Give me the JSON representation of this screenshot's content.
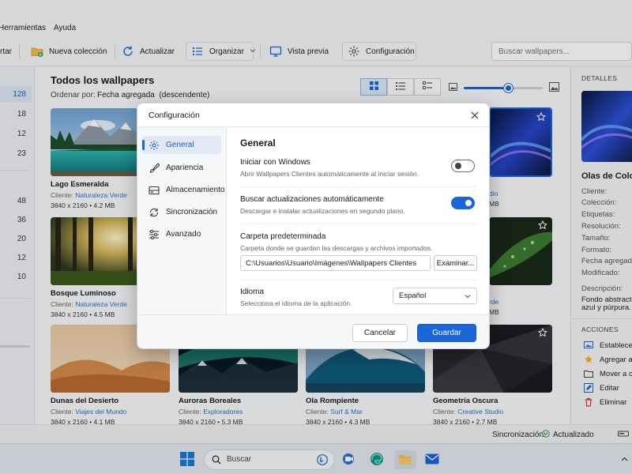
{
  "menubar": {
    "items": [
      "Herramientas",
      "Ayuda"
    ]
  },
  "toolbar": {
    "items": [
      {
        "label": "rtar",
        "icon": "import-icon"
      },
      {
        "label": "Nueva colección",
        "icon": "new-folder-icon"
      },
      {
        "label": "Actualizar",
        "icon": "refresh-icon"
      },
      {
        "label": "Organizar",
        "icon": "list-icon"
      },
      {
        "label": "Vista previa",
        "icon": "monitor-icon"
      },
      {
        "label": "Configuración",
        "icon": "gear-icon"
      }
    ],
    "search_placeholder": "Buscar wallpapers..."
  },
  "sidebar": {
    "counts": [
      "128",
      "18",
      "12",
      "23",
      "48",
      "36",
      "20",
      "12",
      "10"
    ]
  },
  "main": {
    "title": "Todos los wallpapers",
    "sort_label": "Ordenar por:",
    "sort_value": "Fecha agregada",
    "sort_dir": "(descendente)",
    "zoom_level": 0.56,
    "cards": [
      {
        "name": "Lago Esmeralda",
        "client_label": "Cliente:",
        "client": "Naturaleza Verde",
        "resolution": "3840 x 2160",
        "size": "4.2 MB"
      },
      {
        "name": "",
        "client_label": "",
        "client": "dio",
        "resolution": "",
        "size": "MB"
      },
      {
        "name": "Bosque Luminoso",
        "client_label": "Cliente:",
        "client": "Naturaleza Verde",
        "resolution": "3840 x 2160",
        "size": "4.5 MB"
      },
      {
        "name": "",
        "client_label": "",
        "client": "rde",
        "resolution": "",
        "size": "MB"
      },
      {
        "name": "Dunas del Desierto",
        "client_label": "Cliente:",
        "client": "Viajes del Mundo",
        "resolution": "3840 x 2160",
        "size": "4.1 MB"
      },
      {
        "name": "Auroras Boreales",
        "client_label": "Cliente:",
        "client": "Exploradores",
        "resolution": "3840 x 2160",
        "size": "5.3 MB"
      },
      {
        "name": "Ola Rompiente",
        "client_label": "Cliente:",
        "client": "Surf & Mar",
        "resolution": "3840 x 2160",
        "size": "4.3 MB"
      },
      {
        "name": "Geometría Oscura",
        "client_label": "Cliente:",
        "client": "Creative Studio",
        "resolution": "3840 x 2160",
        "size": "2.7 MB"
      }
    ]
  },
  "details": {
    "header": "DETALLES",
    "title": "Olas de Color",
    "labels": [
      "Cliente:",
      "Colección:",
      "Etiquetas:",
      "Resolución:",
      "Tamaño:",
      "Formato:",
      "Fecha agregada:",
      "Modificado:"
    ],
    "description_label": "Descripción:",
    "description_lines": [
      "Fondo abstracto",
      "azul y púrpura."
    ],
    "actions_header": "ACCIONES",
    "actions": [
      {
        "label": "Establecer",
        "icon": "wallpaper-icon"
      },
      {
        "label": "Agregar a",
        "icon": "star-icon"
      },
      {
        "label": "Mover a co",
        "icon": "folder-icon"
      },
      {
        "label": "Editar",
        "icon": "edit-icon"
      },
      {
        "label": "Eliminar",
        "icon": "trash-icon"
      }
    ]
  },
  "statusbar": {
    "sync_label": "Sincronización:",
    "sync_status": "Actualizado"
  },
  "taskbar": {
    "search": "Buscar"
  },
  "dialog": {
    "title": "Configuración",
    "nav": [
      {
        "label": "General",
        "icon": "gear-icon"
      },
      {
        "label": "Apariencia",
        "icon": "brush-icon"
      },
      {
        "label": "Almacenamiento",
        "icon": "storage-icon"
      },
      {
        "label": "Sincronización",
        "icon": "sync-icon"
      },
      {
        "label": "Avanzado",
        "icon": "sliders-icon"
      }
    ],
    "section_title": "General",
    "start_windows": {
      "title": "Iniciar con Windows",
      "desc": "Abrir Wallpapers Clientes automáticamente al iniciar sesión.",
      "enabled": false
    },
    "auto_update": {
      "title": "Buscar actualizaciones automáticamente",
      "desc": "Descargar e instalar actualizaciones en segundo plano.",
      "enabled": true
    },
    "folder": {
      "title": "Carpeta predeterminada",
      "desc": "Carpeta donde se guardan las descargas y archivos importados.",
      "value": "C:\\Usuarios\\Usuario\\Imágenes\\Wallpapers Clientes",
      "browse": "Examinar..."
    },
    "language": {
      "title": "Idioma",
      "desc": "Selecciona el idioma de la aplicación.",
      "value": "Español"
    },
    "cancel": "Cancelar",
    "save": "Guardar"
  }
}
